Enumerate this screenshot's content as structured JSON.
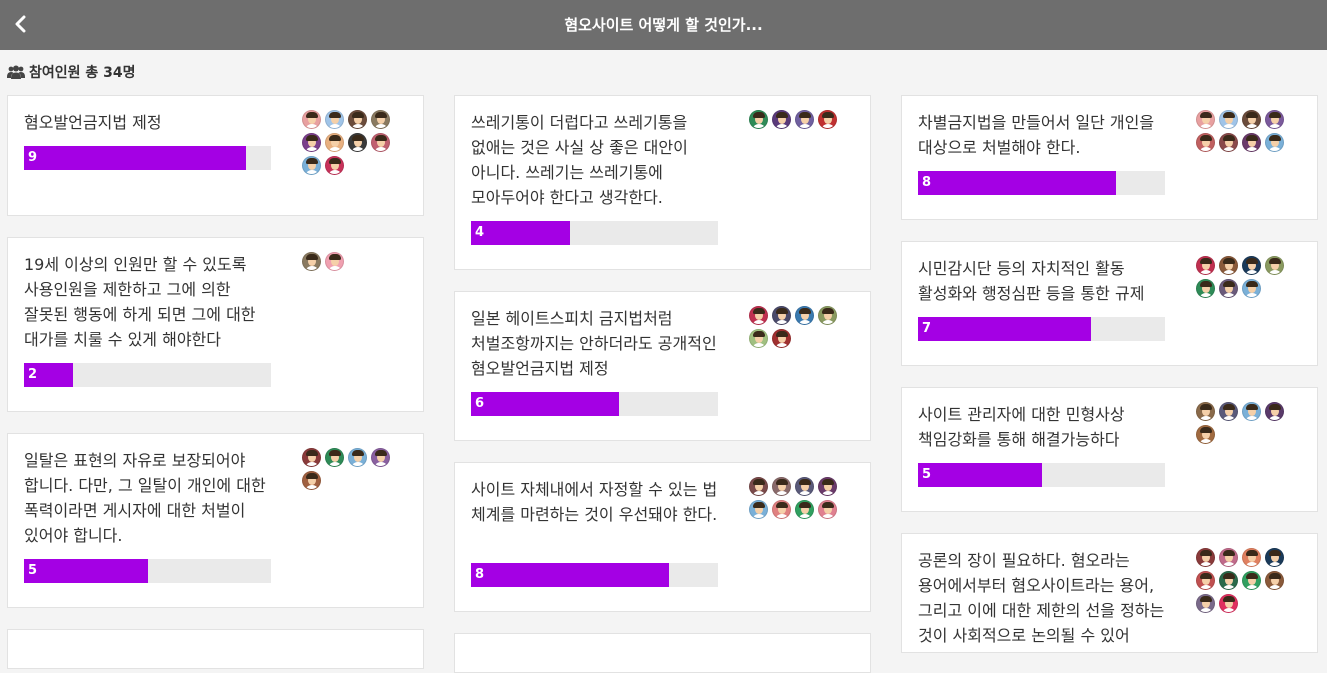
{
  "header": {
    "title": "혐오사이트 어떻게 할 것인가..."
  },
  "participants": {
    "label": "참여인원 총 34명"
  },
  "colors": {
    "bar_fill": "#a400e4",
    "bar_track": "#eaeaea",
    "header_bg": "#6e6e6e"
  },
  "columns": [
    {
      "cards": [
        {
          "text": "혐오발언금지법 제정",
          "count": "9",
          "progress": 0.9,
          "avatars": [
            "#e8a0a0",
            "#a0c4e8",
            "#6b4c3b",
            "#8a7a60",
            "#7b3f8c",
            "#e8b080",
            "#3a3a3a",
            "#c06070",
            "#7ab0d8",
            "#c8325a"
          ]
        },
        {
          "text": "19세 이상의 인원만 할 수 있도록 사용인원을 제한하고 그에 의한 잘못된 행동에 하게 되면 그에 대한 대가를 치룰 수 있게 해야한다",
          "count": "2",
          "progress": 0.2,
          "avatars": [
            "#8a7a60",
            "#f0a0b0"
          ]
        },
        {
          "text": "일탈은 표현의 자유로 보장되어야 합니다. 다만, 그 일탈이 개인에 대한 폭력이라면 게시자에 대한 처벌이 있어야 합니다.",
          "count": "5",
          "progress": 0.5,
          "avatars": [
            "#8a3a3a",
            "#2e8b57",
            "#7ab0d8",
            "#8a60a0",
            "#a06040"
          ]
        }
      ]
    },
    {
      "cards": [
        {
          "text": "쓰레기통이 더럽다고 쓰레기통을 없애는 것은 사실 상 좋은 대안이 아니다. 쓰레기는 쓰레기통에 모아두어야 한다고 생각한다.",
          "count": "4",
          "progress": 0.4,
          "avatars": [
            "#2e8b57",
            "#5a3a7a",
            "#7060a0",
            "#c03030"
          ]
        },
        {
          "text": "일본 헤이트스피치 금지법처럼 처벌조항까지는 안하더라도 공개적인 혐오발언금지법 제정",
          "count": "6",
          "progress": 0.6,
          "avatars": [
            "#c03050",
            "#4a4a6a",
            "#3a7ab0",
            "#8a9a60",
            "#a0c080",
            "#a03030"
          ]
        },
        {
          "text": "사이트 자체내에서 자정할 수 있는 법 체계를 마련하는 것이 우선돼야 한다.",
          "count": "8",
          "progress": 0.8,
          "avatars": [
            "#7a4a4a",
            "#8a6a6a",
            "#5a5a7a",
            "#6a3a6a",
            "#7ab0d8",
            "#e08080",
            "#30a060",
            "#e08090"
          ]
        }
      ]
    },
    {
      "cards": [
        {
          "text": "차별금지법을 만들어서 일단 개인을 대상으로 처벌해야 한다.",
          "count": "8",
          "progress": 0.8,
          "avatars": [
            "#e8a0a0",
            "#a0c4e8",
            "#6b4c3b",
            "#7b5a9c",
            "#c06060",
            "#8a4a4a",
            "#6a3a6a",
            "#7ab0d8"
          ]
        },
        {
          "text": "시민감시단 등의 자치적인 활동 활성화와 행정심판 등을 통한 규제",
          "count": "7",
          "progress": 0.7,
          "avatars": [
            "#c03050",
            "#8a5a3a",
            "#1a3a5a",
            "#8a9a60",
            "#2e8b57",
            "#6a5a7a",
            "#7ab0d8"
          ]
        },
        {
          "text": "사이트 관리자에 대한 민형사상 책임강화를 통해 해결가능하다",
          "count": "5",
          "progress": 0.5,
          "avatars": [
            "#8a6a4a",
            "#5a5a7a",
            "#7ab0d8",
            "#5a3a6a",
            "#a06a40"
          ]
        },
        {
          "text": "공론의 장이 필요하다. 혐오라는 용어에서부터 혐오사이트라는 용어, 그리고 이에 대한 제한의 선을 정하는 것이 사회적으로 논의될 수 있어",
          "count": "",
          "progress": 0,
          "avatars": [
            "#8a3a3a",
            "#c06a8a",
            "#e08060",
            "#1a3a5a",
            "#c05050",
            "#2a6a4a",
            "#30a060",
            "#8a5a3a",
            "#7a6a8a",
            "#e03060"
          ]
        }
      ]
    }
  ]
}
